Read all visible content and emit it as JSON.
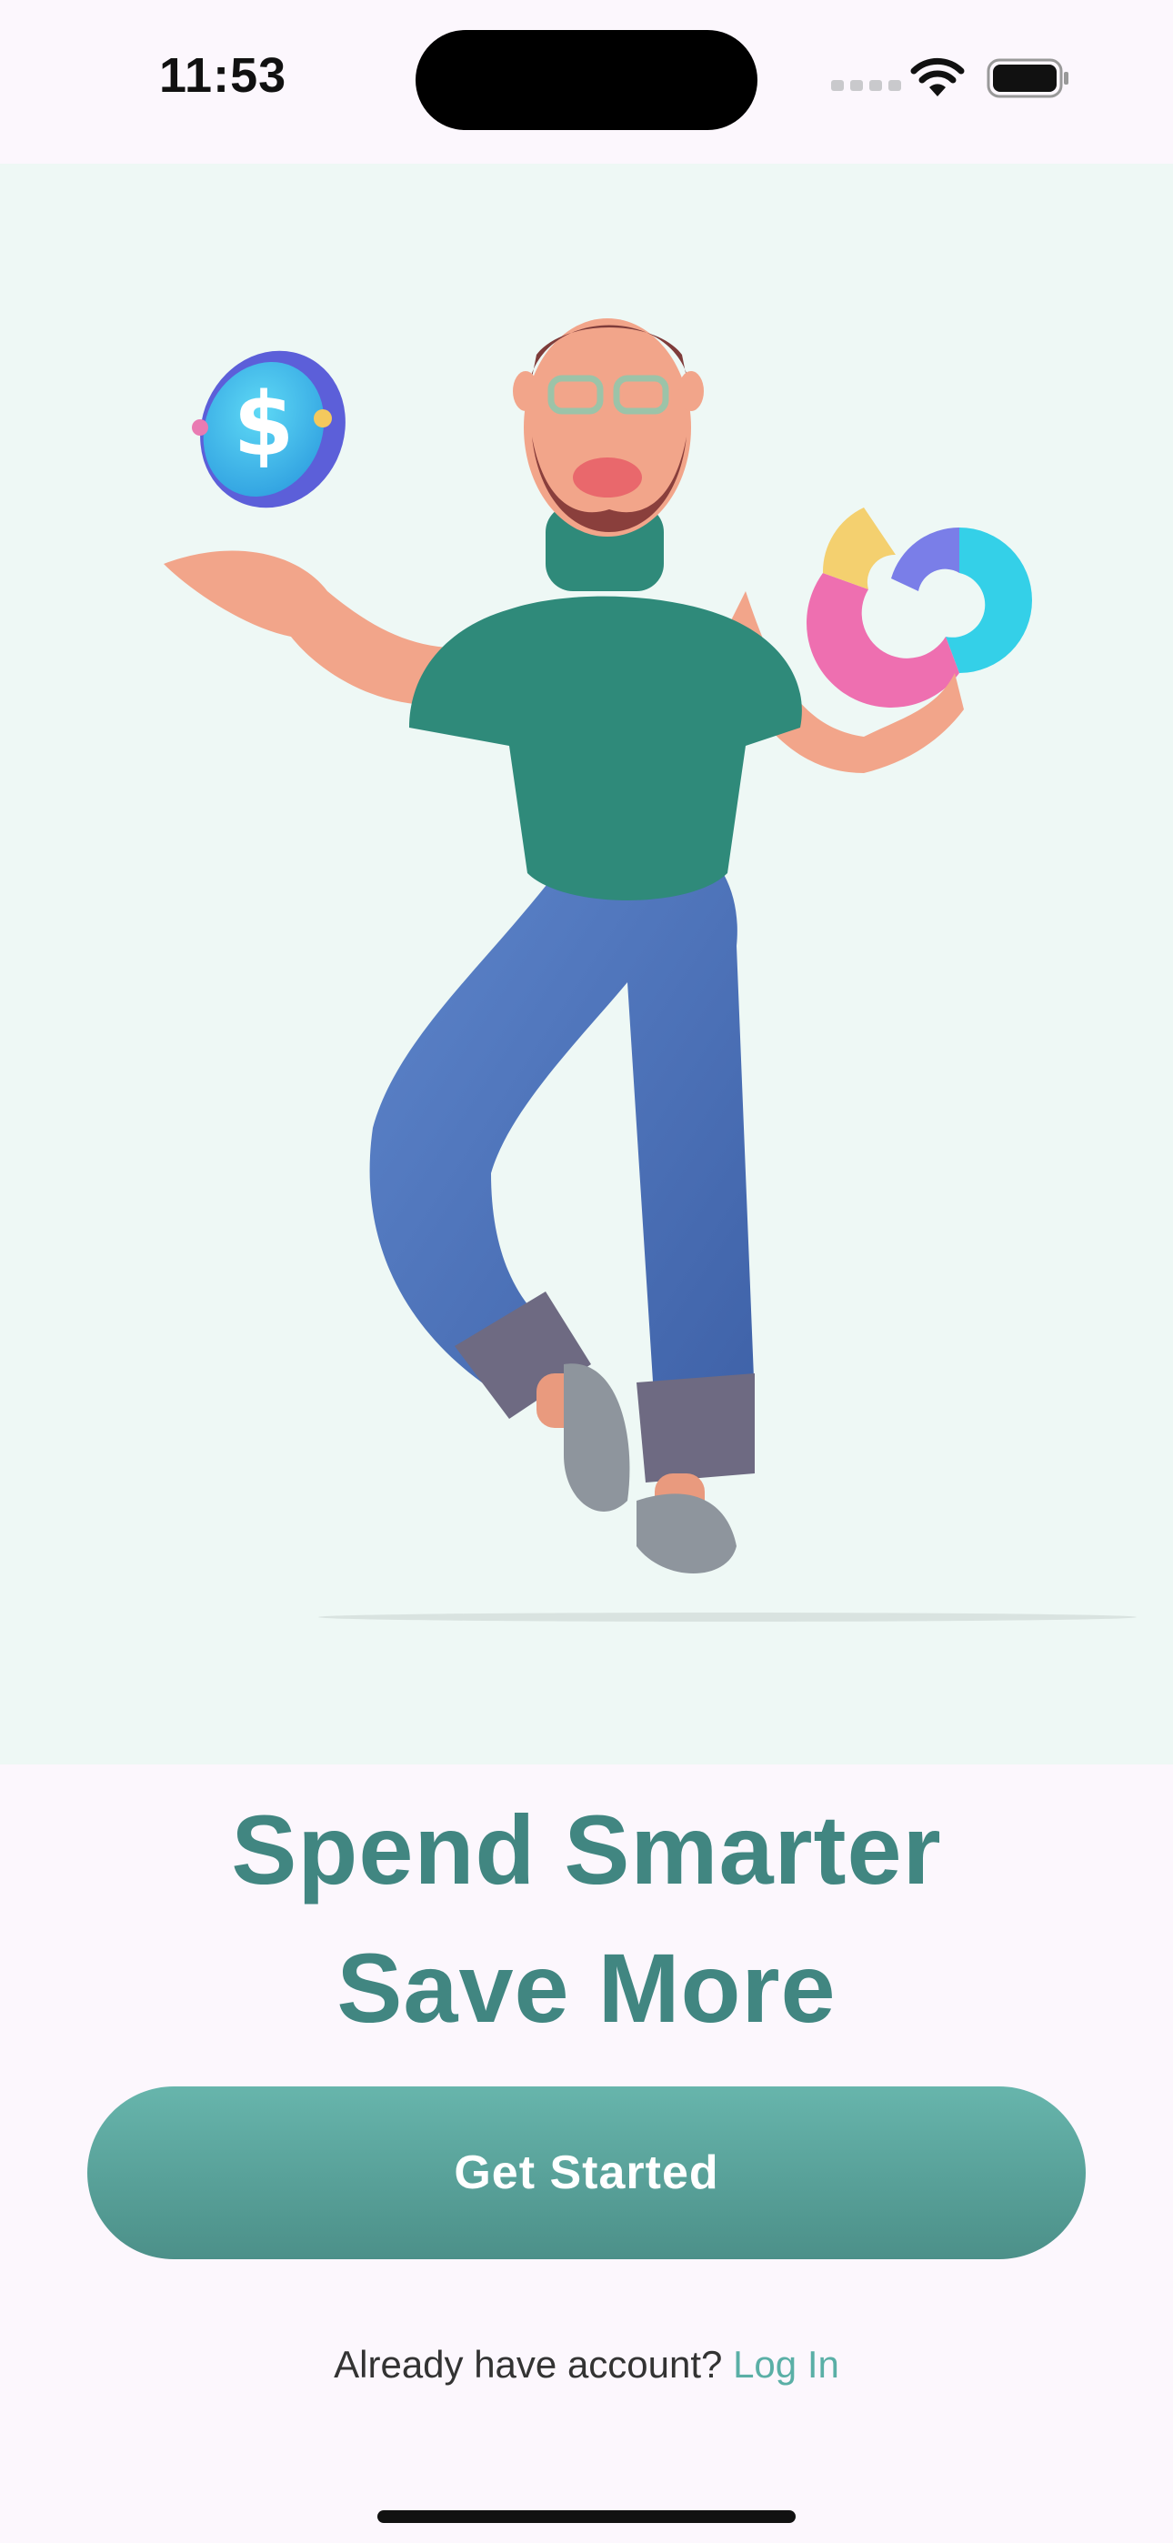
{
  "status_bar": {
    "time": "11:53"
  },
  "hero": {
    "illustration": "3d-man-juggling-coin-and-chart",
    "background": "#EEF8F5"
  },
  "headline": {
    "line1": "Spend Smarter",
    "line2": "Save More",
    "color": "#418681"
  },
  "cta": {
    "label": "Get Started",
    "color": "#5AA39B"
  },
  "login": {
    "prompt": "Already have account? ",
    "link_label": "Log In",
    "link_color": "#5AAFA6"
  }
}
